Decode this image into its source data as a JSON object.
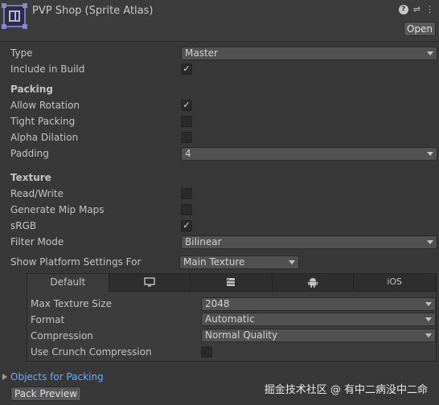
{
  "header": {
    "title": "PVP Shop (Sprite Atlas)",
    "help_icon": "?",
    "layout_icon": "⇌",
    "menu_icon": "⋮",
    "open_label": "Open"
  },
  "fields": {
    "type": {
      "label": "Type",
      "value": "Master"
    },
    "include_in_build": {
      "label": "Include in Build",
      "checked": true
    },
    "packing_title": "Packing",
    "allow_rotation": {
      "label": "Allow Rotation",
      "checked": true
    },
    "tight_packing": {
      "label": "Tight Packing",
      "checked": false
    },
    "alpha_dilation": {
      "label": "Alpha Dilation",
      "checked": false
    },
    "padding": {
      "label": "Padding",
      "value": "4"
    },
    "texture_title": "Texture",
    "read_write": {
      "label": "Read/Write",
      "checked": false
    },
    "generate_mip_maps": {
      "label": "Generate Mip Maps",
      "checked": false
    },
    "srgb": {
      "label": "sRGB",
      "checked": true
    },
    "filter_mode": {
      "label": "Filter Mode",
      "value": "Bilinear"
    },
    "show_platform": {
      "label": "Show Platform Settings For",
      "value": "Main Texture"
    }
  },
  "platform": {
    "tabs": [
      {
        "label": "Default",
        "icon": ""
      },
      {
        "label": "",
        "icon": "monitor-icon"
      },
      {
        "label": "",
        "icon": "server-icon"
      },
      {
        "label": "",
        "icon": "android-icon"
      },
      {
        "label": "iOS",
        "icon": ""
      }
    ],
    "max_texture_size": {
      "label": "Max Texture Size",
      "value": "2048"
    },
    "format": {
      "label": "Format",
      "value": "Automatic"
    },
    "compression": {
      "label": "Compression",
      "value": "Normal Quality"
    },
    "use_crunch": {
      "label": "Use Crunch Compression",
      "checked": false
    }
  },
  "footer": {
    "objects_for_packing": "Objects for Packing",
    "pack_preview": "Pack Preview",
    "watermark": "掘金技术社区 @ 有中二病没中二命"
  },
  "check_glyph": "✓",
  "colors": {
    "background": "#383838",
    "link": "#6fa8ff",
    "field": "#515151"
  }
}
